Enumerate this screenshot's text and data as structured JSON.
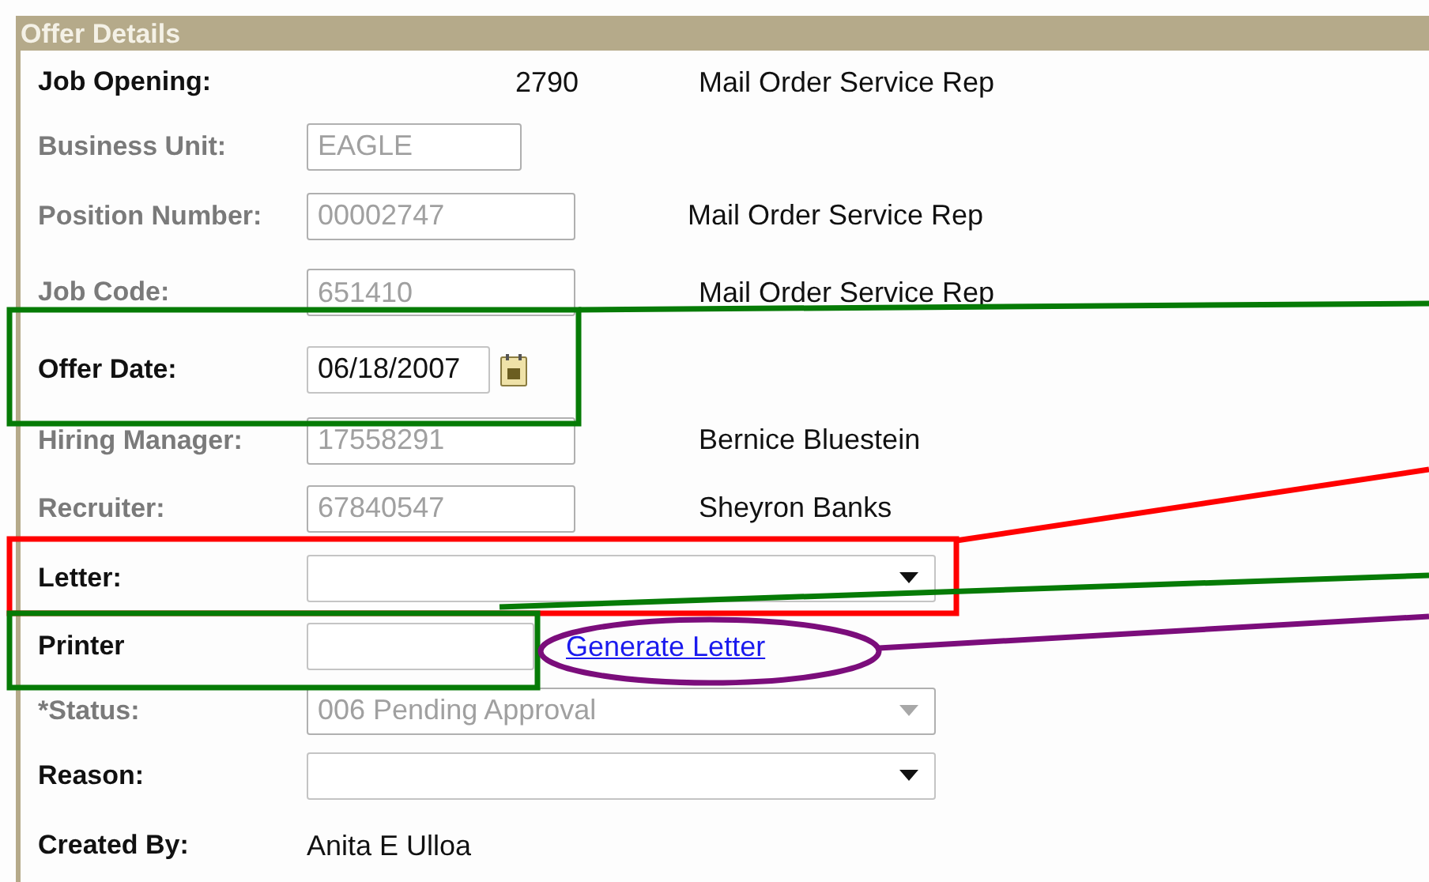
{
  "panel": {
    "title": "Offer Details"
  },
  "rows": [
    {
      "label": "Job Opening:",
      "kind": "display",
      "disabled": false,
      "value": "2790",
      "description": "Mail Order Service Rep"
    },
    {
      "label": "Business Unit:",
      "kind": "text",
      "disabled": true,
      "value": "EAGLE"
    },
    {
      "label": "Position Number:",
      "kind": "text",
      "disabled": true,
      "value": "00002747",
      "description": "Mail Order Service Rep"
    },
    {
      "label": "Job Code:",
      "kind": "text",
      "disabled": true,
      "value": "651410",
      "description": "Mail Order Service Rep"
    },
    {
      "label": "Offer Date:",
      "kind": "date",
      "disabled": false,
      "value": "06/18/2007"
    },
    {
      "label": "Hiring Manager:",
      "kind": "text",
      "disabled": true,
      "value": "17558291",
      "description": "Bernice Bluestein"
    },
    {
      "label": "Recruiter:",
      "kind": "text",
      "disabled": true,
      "value": "67840547",
      "description": "Sheyron Banks"
    },
    {
      "label": "Letter:",
      "kind": "select",
      "disabled": false
    },
    {
      "label": "Printer",
      "kind": "text",
      "disabled": false,
      "link": "Generate Letter"
    },
    {
      "label": "*Status:",
      "kind": "select",
      "disabled": true,
      "value": "006 Pending Approval"
    },
    {
      "label": "Reason:",
      "kind": "select",
      "disabled": false
    },
    {
      "label": "Created By:",
      "kind": "display",
      "disabled": false,
      "value": "Anita E Ulloa"
    }
  ],
  "annotations": [
    {
      "kind": "box",
      "color": "#067b06"
    },
    {
      "kind": "line",
      "color": "#067b06"
    },
    {
      "kind": "box",
      "color": "#ff0000"
    },
    {
      "kind": "line",
      "color": "#ff0000"
    },
    {
      "kind": "box",
      "color": "#067b06"
    },
    {
      "kind": "line",
      "color": "#067b06"
    },
    {
      "kind": "ellipse",
      "color": "#7b0d7b"
    },
    {
      "kind": "line",
      "color": "#7b0d7b"
    }
  ]
}
